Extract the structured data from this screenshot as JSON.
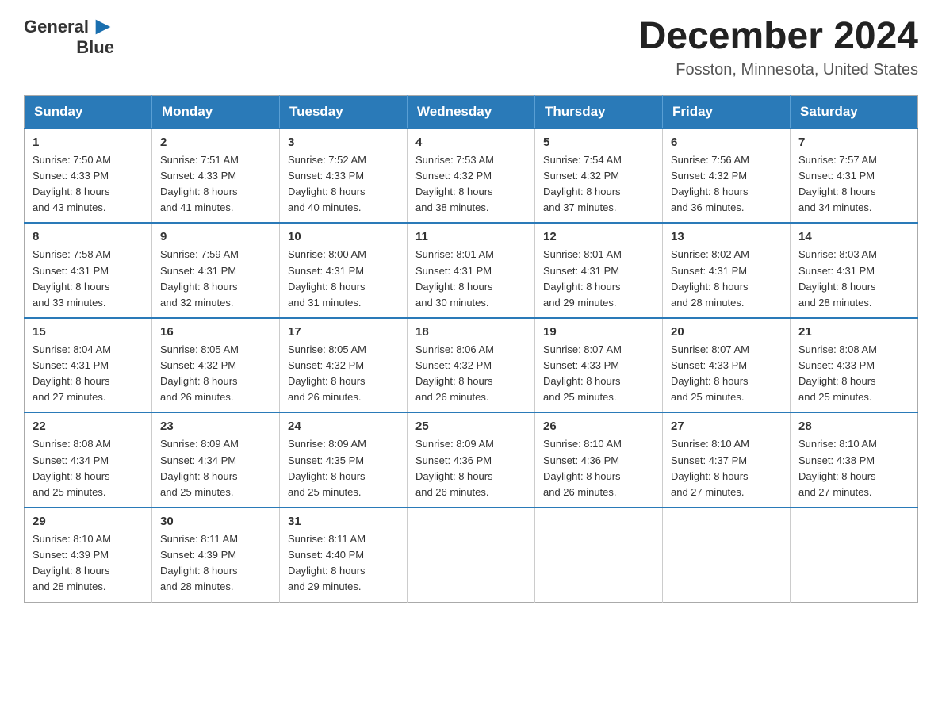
{
  "logo": {
    "text_general": "General",
    "text_blue": "Blue",
    "arrow_color": "#1a6faf"
  },
  "header": {
    "title": "December 2024",
    "subtitle": "Fosston, Minnesota, United States"
  },
  "weekdays": [
    "Sunday",
    "Monday",
    "Tuesday",
    "Wednesday",
    "Thursday",
    "Friday",
    "Saturday"
  ],
  "weeks": [
    [
      {
        "day": "1",
        "sunrise": "7:50 AM",
        "sunset": "4:33 PM",
        "daylight": "8 hours and 43 minutes."
      },
      {
        "day": "2",
        "sunrise": "7:51 AM",
        "sunset": "4:33 PM",
        "daylight": "8 hours and 41 minutes."
      },
      {
        "day": "3",
        "sunrise": "7:52 AM",
        "sunset": "4:33 PM",
        "daylight": "8 hours and 40 minutes."
      },
      {
        "day": "4",
        "sunrise": "7:53 AM",
        "sunset": "4:32 PM",
        "daylight": "8 hours and 38 minutes."
      },
      {
        "day": "5",
        "sunrise": "7:54 AM",
        "sunset": "4:32 PM",
        "daylight": "8 hours and 37 minutes."
      },
      {
        "day": "6",
        "sunrise": "7:56 AM",
        "sunset": "4:32 PM",
        "daylight": "8 hours and 36 minutes."
      },
      {
        "day": "7",
        "sunrise": "7:57 AM",
        "sunset": "4:31 PM",
        "daylight": "8 hours and 34 minutes."
      }
    ],
    [
      {
        "day": "8",
        "sunrise": "7:58 AM",
        "sunset": "4:31 PM",
        "daylight": "8 hours and 33 minutes."
      },
      {
        "day": "9",
        "sunrise": "7:59 AM",
        "sunset": "4:31 PM",
        "daylight": "8 hours and 32 minutes."
      },
      {
        "day": "10",
        "sunrise": "8:00 AM",
        "sunset": "4:31 PM",
        "daylight": "8 hours and 31 minutes."
      },
      {
        "day": "11",
        "sunrise": "8:01 AM",
        "sunset": "4:31 PM",
        "daylight": "8 hours and 30 minutes."
      },
      {
        "day": "12",
        "sunrise": "8:01 AM",
        "sunset": "4:31 PM",
        "daylight": "8 hours and 29 minutes."
      },
      {
        "day": "13",
        "sunrise": "8:02 AM",
        "sunset": "4:31 PM",
        "daylight": "8 hours and 28 minutes."
      },
      {
        "day": "14",
        "sunrise": "8:03 AM",
        "sunset": "4:31 PM",
        "daylight": "8 hours and 28 minutes."
      }
    ],
    [
      {
        "day": "15",
        "sunrise": "8:04 AM",
        "sunset": "4:31 PM",
        "daylight": "8 hours and 27 minutes."
      },
      {
        "day": "16",
        "sunrise": "8:05 AM",
        "sunset": "4:32 PM",
        "daylight": "8 hours and 26 minutes."
      },
      {
        "day": "17",
        "sunrise": "8:05 AM",
        "sunset": "4:32 PM",
        "daylight": "8 hours and 26 minutes."
      },
      {
        "day": "18",
        "sunrise": "8:06 AM",
        "sunset": "4:32 PM",
        "daylight": "8 hours and 26 minutes."
      },
      {
        "day": "19",
        "sunrise": "8:07 AM",
        "sunset": "4:33 PM",
        "daylight": "8 hours and 25 minutes."
      },
      {
        "day": "20",
        "sunrise": "8:07 AM",
        "sunset": "4:33 PM",
        "daylight": "8 hours and 25 minutes."
      },
      {
        "day": "21",
        "sunrise": "8:08 AM",
        "sunset": "4:33 PM",
        "daylight": "8 hours and 25 minutes."
      }
    ],
    [
      {
        "day": "22",
        "sunrise": "8:08 AM",
        "sunset": "4:34 PM",
        "daylight": "8 hours and 25 minutes."
      },
      {
        "day": "23",
        "sunrise": "8:09 AM",
        "sunset": "4:34 PM",
        "daylight": "8 hours and 25 minutes."
      },
      {
        "day": "24",
        "sunrise": "8:09 AM",
        "sunset": "4:35 PM",
        "daylight": "8 hours and 25 minutes."
      },
      {
        "day": "25",
        "sunrise": "8:09 AM",
        "sunset": "4:36 PM",
        "daylight": "8 hours and 26 minutes."
      },
      {
        "day": "26",
        "sunrise": "8:10 AM",
        "sunset": "4:36 PM",
        "daylight": "8 hours and 26 minutes."
      },
      {
        "day": "27",
        "sunrise": "8:10 AM",
        "sunset": "4:37 PM",
        "daylight": "8 hours and 27 minutes."
      },
      {
        "day": "28",
        "sunrise": "8:10 AM",
        "sunset": "4:38 PM",
        "daylight": "8 hours and 27 minutes."
      }
    ],
    [
      {
        "day": "29",
        "sunrise": "8:10 AM",
        "sunset": "4:39 PM",
        "daylight": "8 hours and 28 minutes."
      },
      {
        "day": "30",
        "sunrise": "8:11 AM",
        "sunset": "4:39 PM",
        "daylight": "8 hours and 28 minutes."
      },
      {
        "day": "31",
        "sunrise": "8:11 AM",
        "sunset": "4:40 PM",
        "daylight": "8 hours and 29 minutes."
      },
      null,
      null,
      null,
      null
    ]
  ],
  "labels": {
    "sunrise": "Sunrise:",
    "sunset": "Sunset:",
    "daylight": "Daylight:"
  }
}
